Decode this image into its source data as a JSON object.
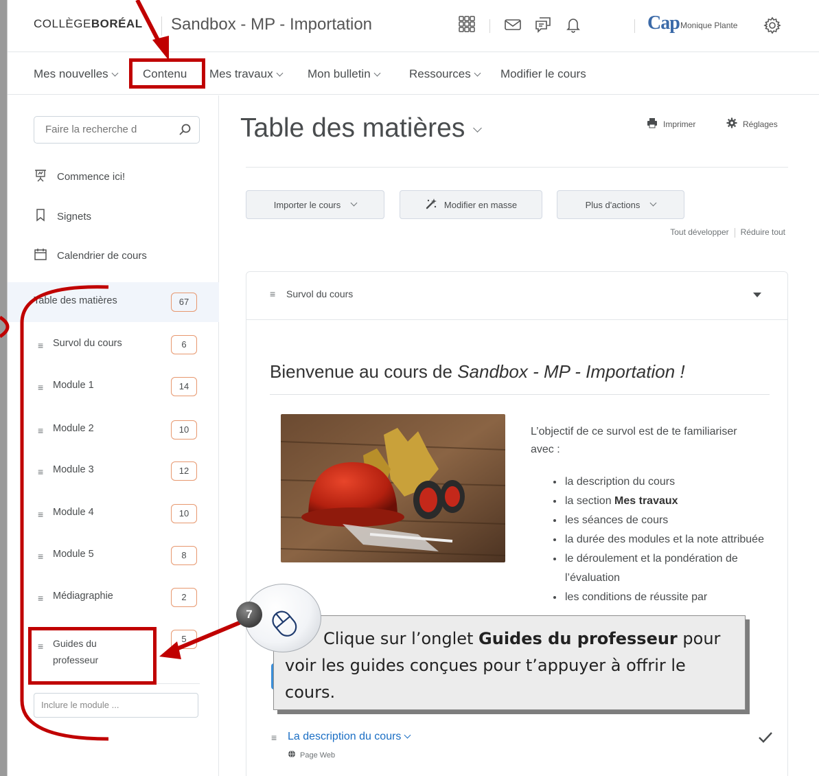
{
  "header": {
    "logo_prefix": "COLLÈGE",
    "logo_bold": "BORÉAL",
    "course_title": "Sandbox - MP - Importation",
    "cap_logo": "Cap",
    "user_name": "Monique Plante"
  },
  "nav": {
    "items": [
      {
        "label": "Mes nouvelles",
        "has_menu": true
      },
      {
        "label": "Contenu",
        "has_menu": false
      },
      {
        "label": "Mes travaux",
        "has_menu": true
      },
      {
        "label": "Mon bulletin",
        "has_menu": true
      },
      {
        "label": "Ressources",
        "has_menu": true
      },
      {
        "label": "Modifier le cours",
        "has_menu": false
      }
    ]
  },
  "sidebar": {
    "search_placeholder": "Faire la recherche d",
    "links": [
      {
        "label": "Commence ici!",
        "icon": "presentation-icon"
      },
      {
        "label": "Signets",
        "icon": "bookmark-icon"
      },
      {
        "label": "Calendrier de cours",
        "icon": "calendar-icon"
      }
    ],
    "toc": {
      "label": "Table des matières",
      "count": "67"
    },
    "modules": [
      {
        "label": "Survol du cours",
        "count": "6"
      },
      {
        "label": "Module 1",
        "count": "14"
      },
      {
        "label": "Module 2",
        "count": "10"
      },
      {
        "label": "Module 3",
        "count": "12"
      },
      {
        "label": "Module 4",
        "count": "10"
      },
      {
        "label": "Module 5",
        "count": "8"
      },
      {
        "label": "Médiagraphie",
        "count": "2"
      }
    ],
    "guides": {
      "label_line1": "Guides du",
      "label_line2": "professeur",
      "count": "5"
    },
    "include_placeholder": "Inclure le module ..."
  },
  "main": {
    "title": "Table des matières",
    "print_label": "Imprimer",
    "settings_label": "Réglages",
    "buttons": {
      "import": "Importer le cours",
      "bulk_edit": "Modifier en masse",
      "more_actions": "Plus d'actions"
    },
    "expand_all": "Tout développer",
    "collapse_all": "Réduire tout",
    "module_name": "Survol du cours",
    "welcome_prefix": "Bienvenue au cours de ",
    "welcome_course": "Sandbox - MP - Importation !",
    "intro_text": "L’objectif de ce survol est de te familiariser avec :",
    "bullets": [
      {
        "text": "la description du cours"
      },
      {
        "pre": "la section ",
        "bold": "Mes travaux"
      },
      {
        "text": "les séances de cours"
      },
      {
        "text": "la durée des modules et la note attribuée"
      },
      {
        "text": "le déroulement et la pondération de l’évaluation"
      },
      {
        "text": "les conditions de réussite par"
      }
    ],
    "topic": {
      "title": "La description du cours",
      "type": "Page Web"
    }
  },
  "annotation": {
    "step": "7",
    "text_pre": "Clique sur l’onglet ",
    "text_bold": "Guides du professeur",
    "text_post": " pour voir les guides conçues pour t’appuyer à offrir le cours."
  },
  "colors": {
    "annotation_red": "#c00000",
    "badge_border": "#e7976e",
    "link_blue": "#1a6ec4",
    "primary_blue": "#3b8ed8"
  }
}
